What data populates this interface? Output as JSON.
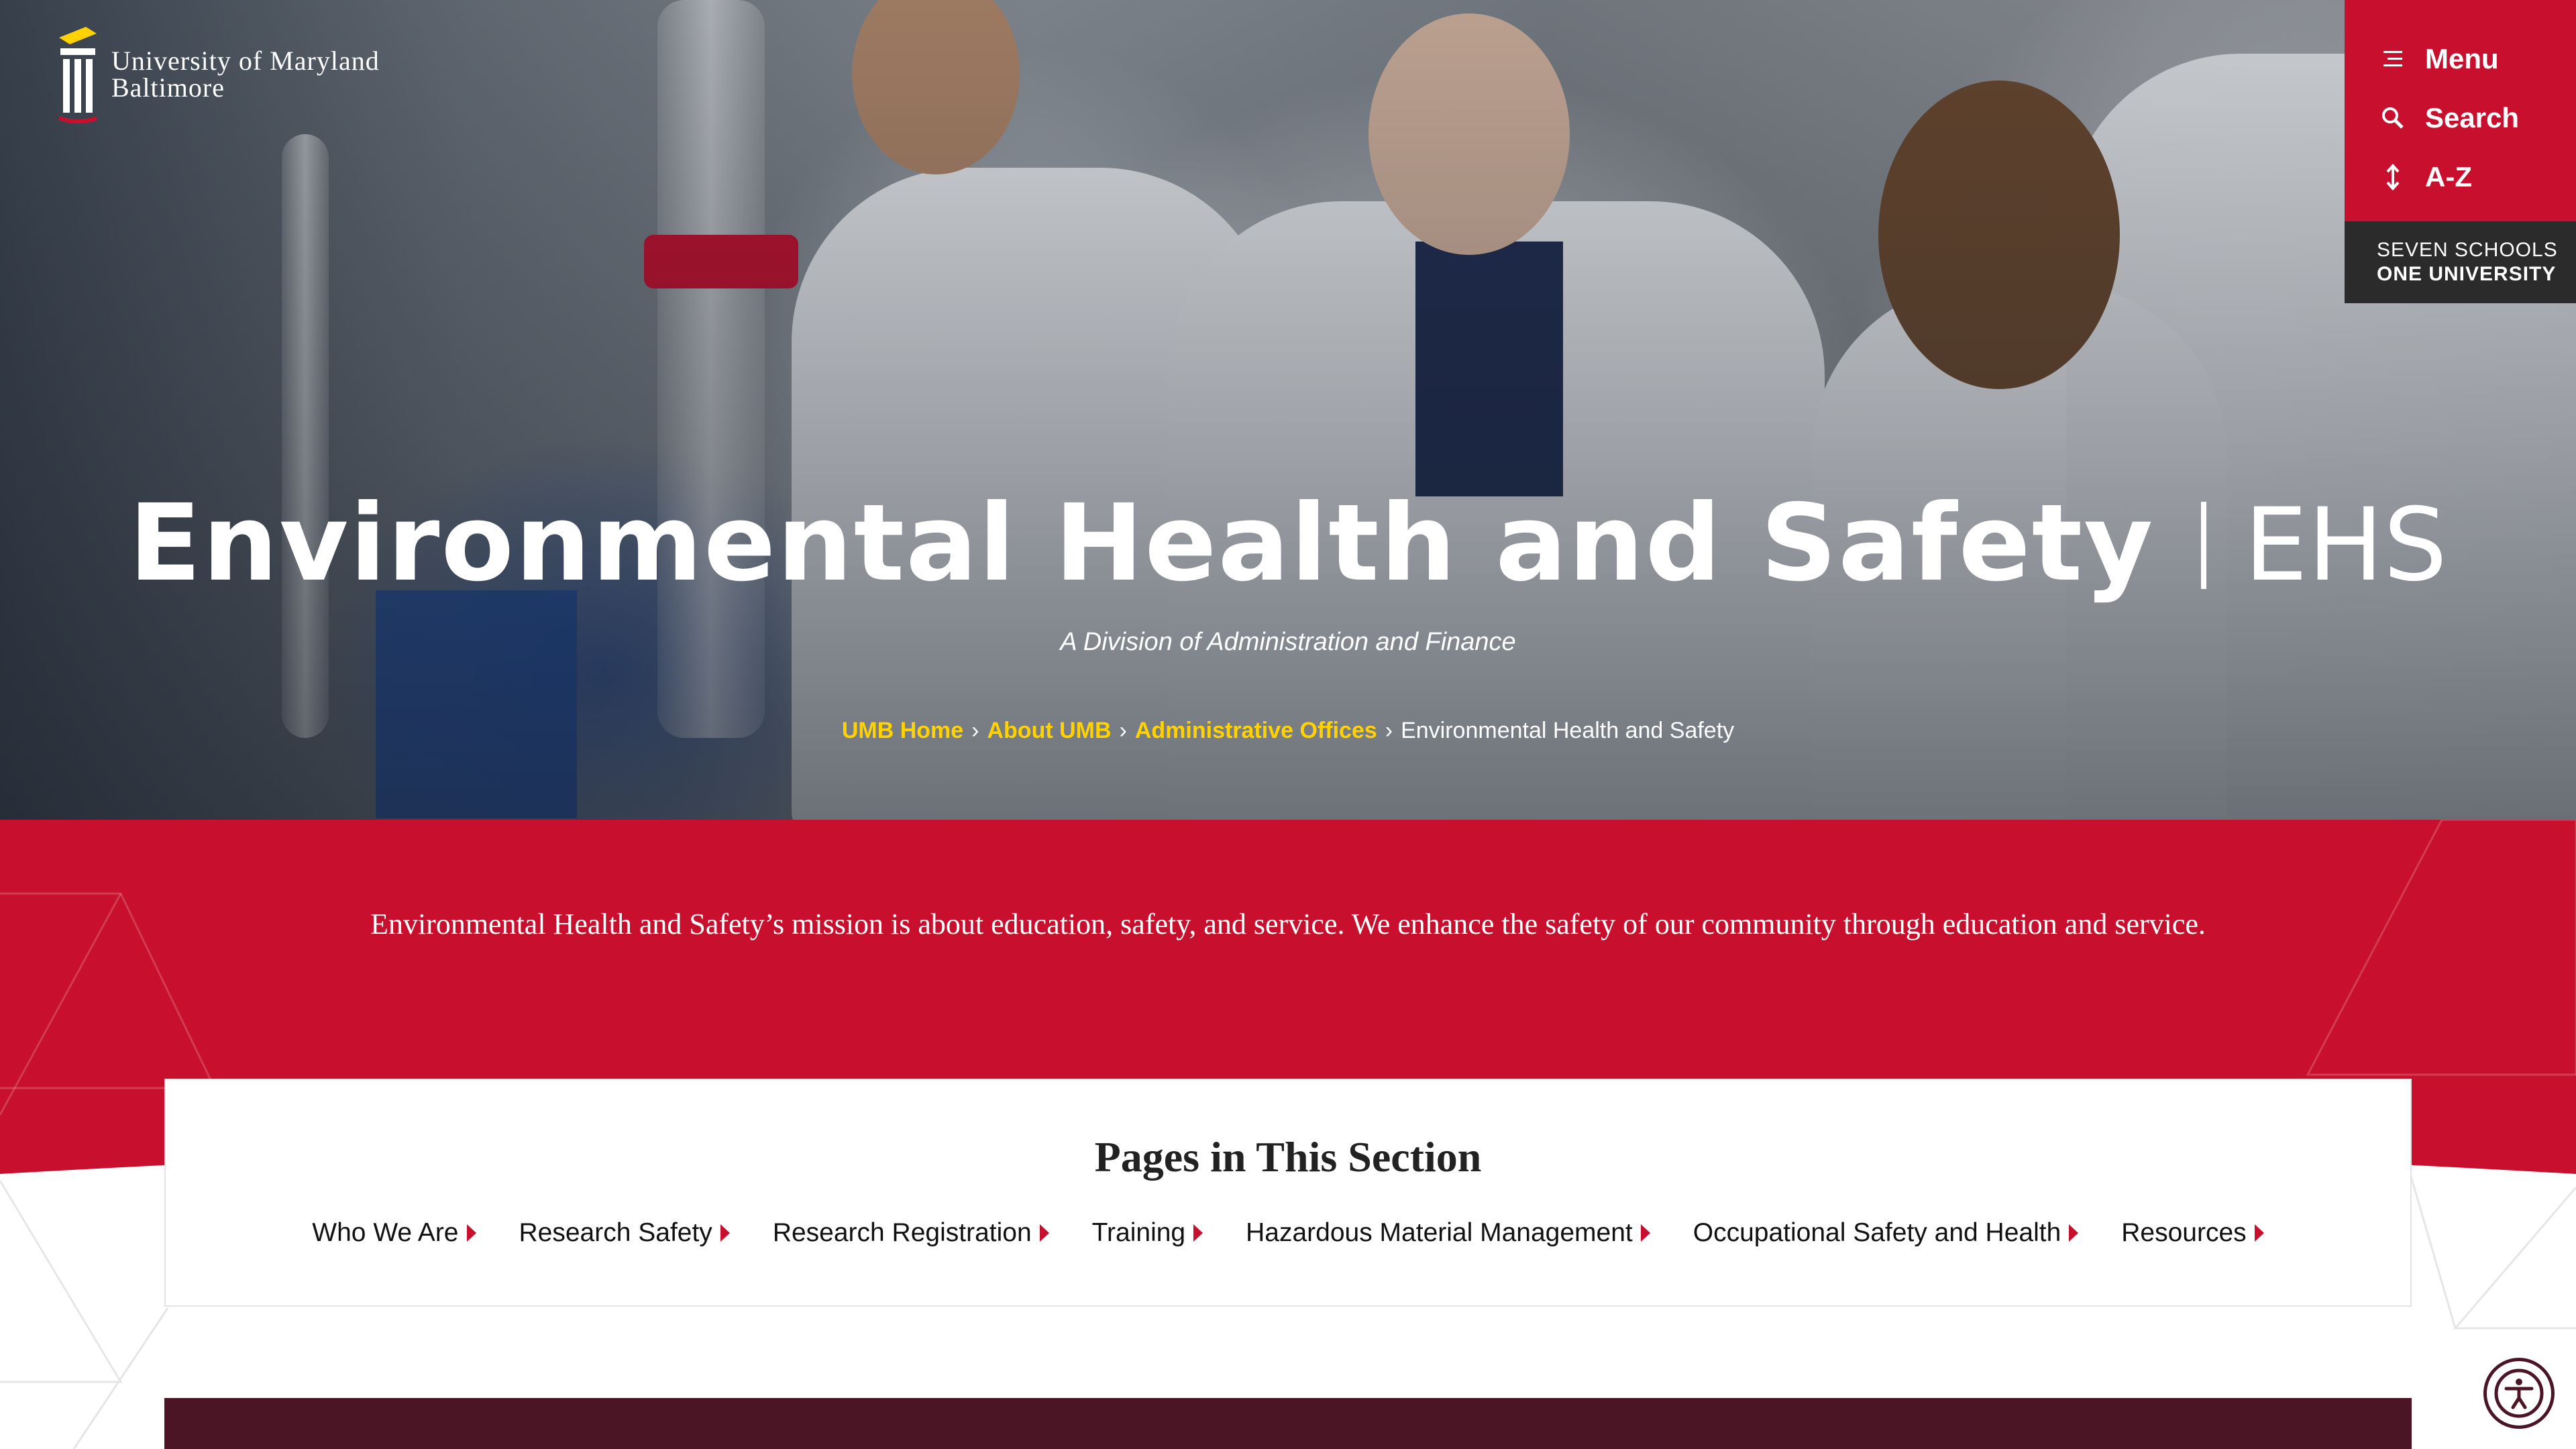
{
  "brand": {
    "university_line1": "University of Maryland",
    "university_line2": "Baltimore",
    "colors": {
      "red": "#c8102e",
      "gold": "#ffd200",
      "maroon": "#4b1526",
      "dark": "#2b2b2b"
    }
  },
  "top_panel": {
    "menu_label": "Menu",
    "search_label": "Search",
    "az_label": "A-Z",
    "tagline_line1": "SEVEN SCHOOLS",
    "tagline_line2": "ONE UNIVERSITY",
    "icons": [
      "menu-icon",
      "search-icon",
      "az-arrows-icon"
    ]
  },
  "hero": {
    "title": "Environmental Health and Safety",
    "abbreviation": "EHS",
    "subtitle": "A Division of Administration and Finance",
    "breadcrumb": [
      {
        "label": "UMB Home",
        "link": true
      },
      {
        "label": "About UMB",
        "link": true
      },
      {
        "label": "Administrative Offices",
        "link": true
      },
      {
        "label": "Environmental Health and Safety",
        "link": false
      }
    ]
  },
  "mission": {
    "text": "Environmental Health and Safety’s mission is about education, safety, and service. We enhance the safety of our community through education and service."
  },
  "section_nav": {
    "title": "Pages in This Section",
    "items": [
      "Who We Are",
      "Research Safety",
      "Research Registration",
      "Training",
      "Hazardous Material Management",
      "Occupational Safety and Health",
      "Resources"
    ]
  },
  "accessibility": {
    "icon": "accessibility-icon"
  }
}
